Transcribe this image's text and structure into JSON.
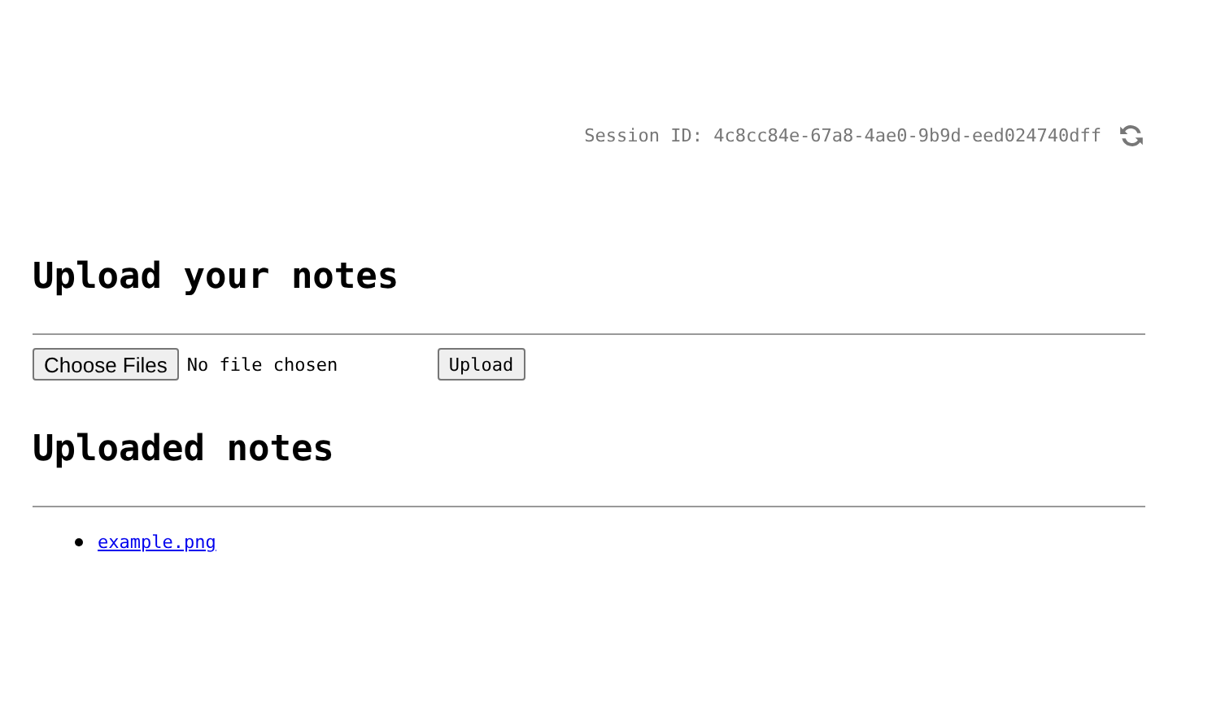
{
  "session": {
    "label": "Session ID: 4c8cc84e-67a8-4ae0-9b9d-eed024740dff"
  },
  "upload_section": {
    "heading": "Upload your notes",
    "file_button": "Choose Files",
    "file_status": "No file chosen",
    "submit_button": "Upload"
  },
  "notes_section": {
    "heading": "Uploaded notes",
    "files": [
      "example.png"
    ]
  }
}
